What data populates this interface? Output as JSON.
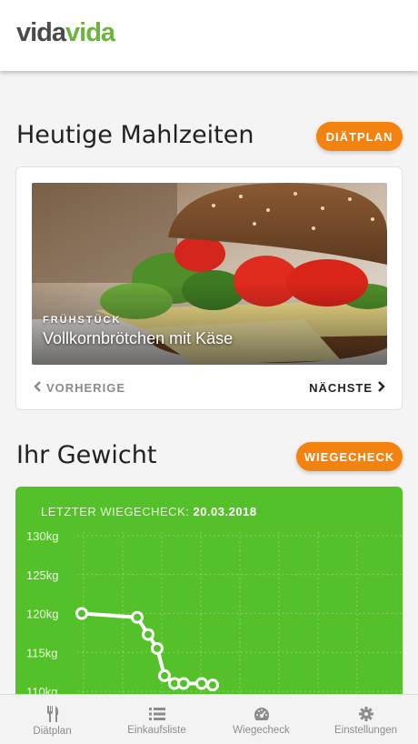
{
  "header": {
    "logo_part1": "vida",
    "logo_part2": "vida"
  },
  "meals": {
    "title": "Heutige Mahlzeiten",
    "plan_button": "DIÄTPLAN",
    "category": "FRÜHSTÜCK",
    "name": "Vollkornbrötchen mit Käse",
    "prev_label": "VORHERIGE",
    "next_label": "NÄCHSTE"
  },
  "weight": {
    "title": "Ihr Gewicht",
    "check_button": "WIEGECHECK",
    "last_check_label": "LETZTER WIEGECHECK:",
    "last_check_date": "20.03.2018"
  },
  "chart_data": {
    "type": "line",
    "y_ticks": [
      "130kg",
      "125kg",
      "120kg",
      "115kg",
      "110kg"
    ],
    "ylim": [
      110,
      130
    ],
    "grid": true,
    "series": [
      {
        "values": [
          120,
          119.5,
          117.3,
          115.5,
          112,
          111,
          111,
          111,
          110.8
        ]
      }
    ]
  },
  "tabs": [
    {
      "label": "Diätplan",
      "icon": "cutlery-icon"
    },
    {
      "label": "Einkaufsliste",
      "icon": "list-icon"
    },
    {
      "label": "Wiegecheck",
      "icon": "gauge-icon"
    },
    {
      "label": "Einstellungen",
      "icon": "gear-icon"
    }
  ],
  "colors": {
    "accent": "#f4820f",
    "brand_green": "#6cb33f",
    "chart_bg": "#55c12a"
  }
}
